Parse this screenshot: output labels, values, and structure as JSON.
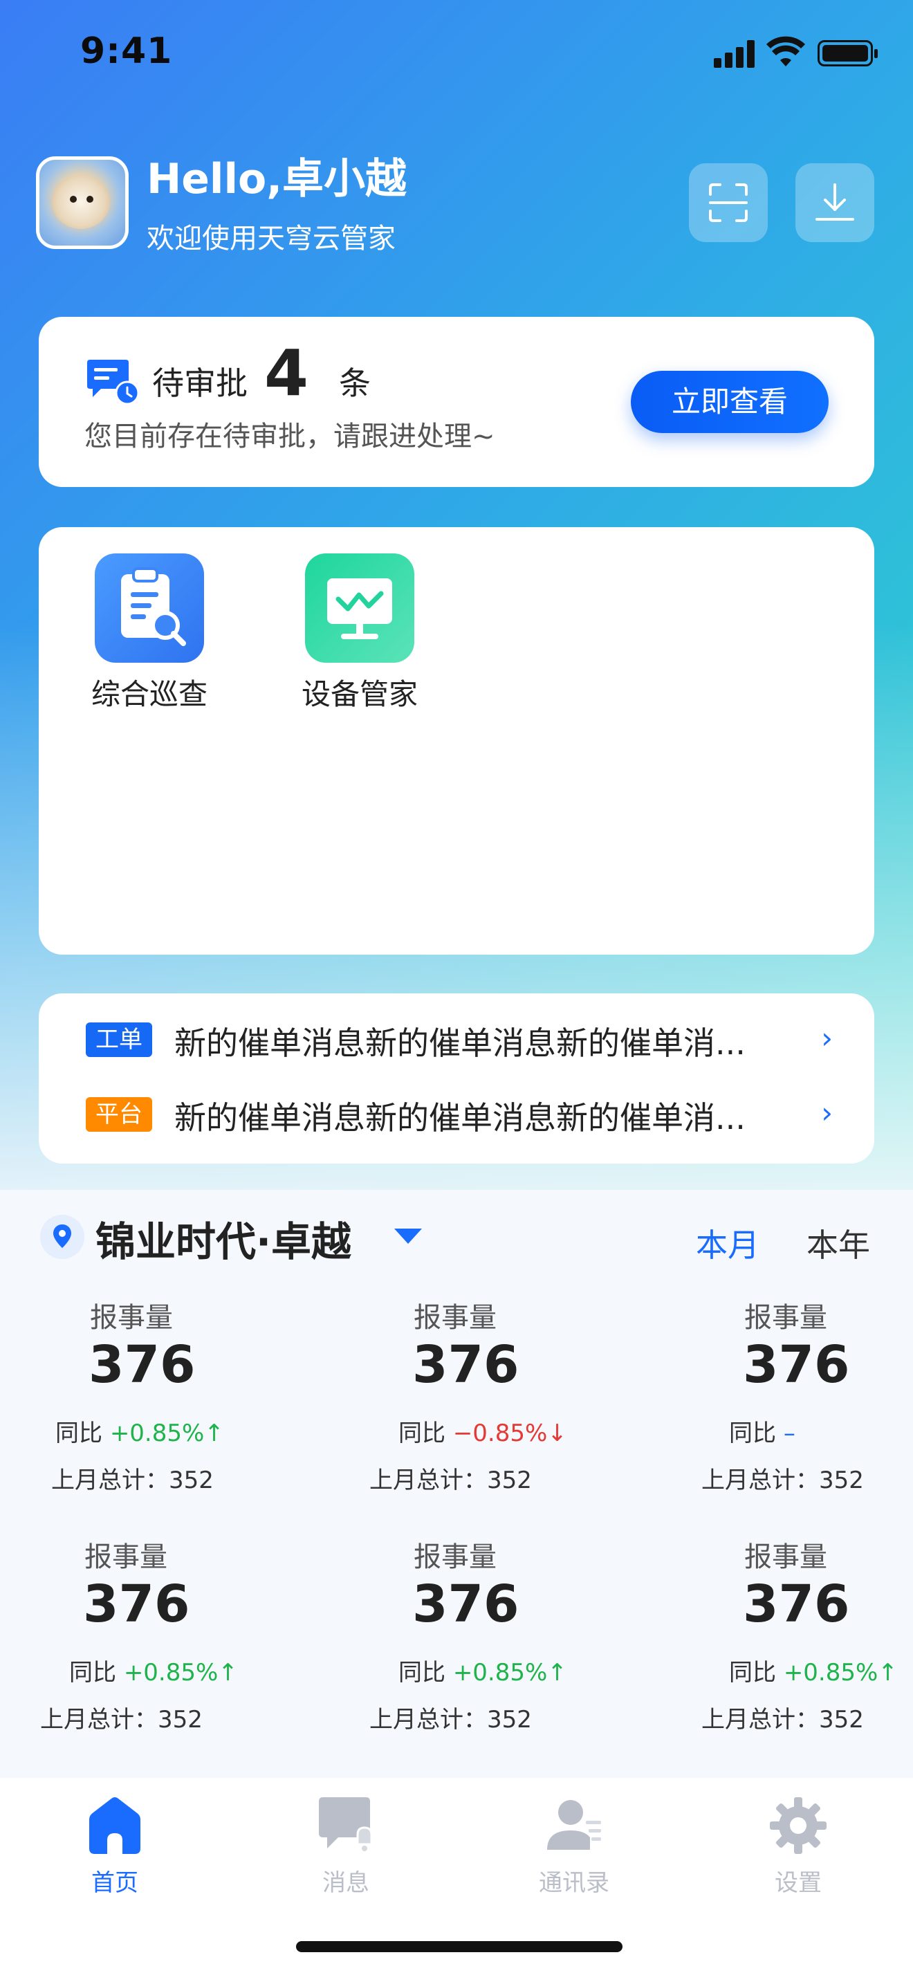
{
  "status_bar": {
    "time": "9:41"
  },
  "header": {
    "greeting": "Hello,卓小越",
    "subtitle": "欢迎使用天穹云管家",
    "buttons": [
      {
        "icon": "scan-icon"
      },
      {
        "icon": "download-icon"
      }
    ]
  },
  "approval": {
    "prefix": "待审批",
    "count": "4",
    "unit": "条",
    "message": "您目前存在待审批，请跟进处理~",
    "button_label": "立即查看"
  },
  "apps": [
    {
      "label": "综合巡查",
      "icon": "inspection-icon",
      "color_from": "#4A9BFF",
      "color_to": "#2F73F0"
    },
    {
      "label": "设备管家",
      "icon": "device-monitor-icon",
      "color_from": "#1ED69C",
      "color_to": "#5BE3B8"
    }
  ],
  "notices": [
    {
      "tag": "工单",
      "tag_color": "#1669F5",
      "text": "新的催单消息新的催单消息新的催单消..."
    },
    {
      "tag": "平台",
      "tag_color": "#FF8A00",
      "text": "新的催单消息新的催单消息新的催单消..."
    }
  ],
  "location": {
    "name": "锦业时代·卓越",
    "periods": [
      {
        "label": "本月",
        "active": true
      },
      {
        "label": "本年",
        "active": false
      }
    ]
  },
  "stats": [
    {
      "label": "报事量",
      "value": "376",
      "yoy_label": "同比",
      "yoy_value": "+0.85%",
      "trend": "up",
      "last_label": "上月总计：",
      "last_value": "352"
    },
    {
      "label": "报事量",
      "value": "376",
      "yoy_label": "同比",
      "yoy_value": "−0.85%",
      "trend": "down",
      "last_label": "上月总计：",
      "last_value": "352"
    },
    {
      "label": "报事量",
      "value": "376",
      "yoy_label": "同比",
      "yoy_value": "–",
      "trend": "flat",
      "last_label": "上月总计：",
      "last_value": "352"
    },
    {
      "label": "报事量",
      "value": "376",
      "yoy_label": "同比",
      "yoy_value": "+0.85%",
      "trend": "up",
      "last_label": "上月总计：",
      "last_value": "352"
    },
    {
      "label": "报事量",
      "value": "376",
      "yoy_label": "同比",
      "yoy_value": "+0.85%",
      "trend": "up",
      "last_label": "上月总计：",
      "last_value": "352"
    },
    {
      "label": "报事量",
      "value": "376",
      "yoy_label": "同比",
      "yoy_value": "+0.85%",
      "trend": "up",
      "last_label": "上月总计：",
      "last_value": "352"
    }
  ],
  "tabbar": [
    {
      "label": "首页",
      "icon": "home-icon",
      "active": true
    },
    {
      "label": "消息",
      "icon": "message-icon",
      "active": false
    },
    {
      "label": "通讯录",
      "icon": "contacts-icon",
      "active": false
    },
    {
      "label": "设置",
      "icon": "settings-icon",
      "active": false
    }
  ],
  "colors": {
    "primary": "#1A6CFF",
    "up": "#1FB34C",
    "down": "#E53935",
    "tab_inactive": "#B9BEC8"
  }
}
